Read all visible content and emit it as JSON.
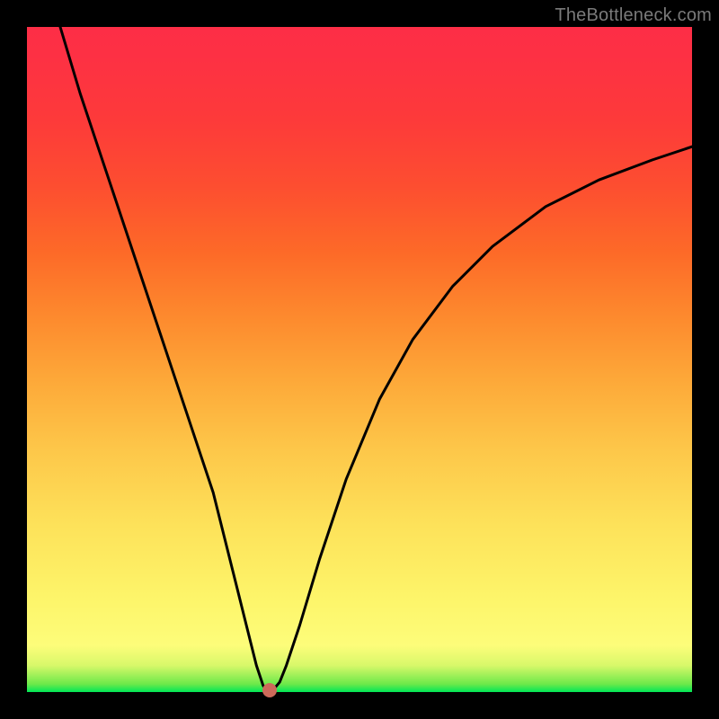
{
  "watermark": "TheBottleneck.com",
  "chart_data": {
    "type": "line",
    "title": "",
    "xlabel": "",
    "ylabel": "",
    "xlim": [
      0,
      100
    ],
    "ylim": [
      0,
      100
    ],
    "series": [
      {
        "name": "curve",
        "x": [
          5,
          8,
          12,
          16,
          20,
          24,
          28,
          31,
          33,
          34.5,
          35.5,
          36,
          37,
          38,
          39,
          41,
          44,
          48,
          53,
          58,
          64,
          70,
          78,
          86,
          94,
          100
        ],
        "y": [
          100,
          90,
          78,
          66,
          54,
          42,
          30,
          18,
          10,
          4,
          1,
          0.3,
          0.3,
          1.5,
          4,
          10,
          20,
          32,
          44,
          53,
          61,
          67,
          73,
          77,
          80,
          82
        ]
      }
    ],
    "marker": {
      "x": 36.5,
      "y": 0.3
    },
    "colors": {
      "curve": "#000000",
      "marker": "#cc6a5a",
      "gradient_top": "#fd2e46",
      "gradient_bottom": "#00e756"
    }
  }
}
